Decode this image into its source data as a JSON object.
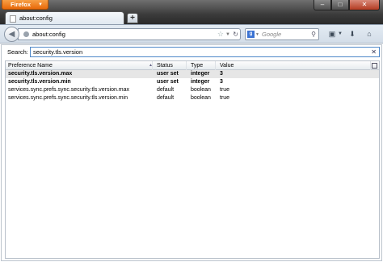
{
  "app": {
    "menu_button": "Firefox"
  },
  "window_controls": {
    "minimize": "–",
    "maximize": "□",
    "close": "✕"
  },
  "tabs": [
    {
      "title": "about:config"
    }
  ],
  "new_tab_label": "+",
  "navbar": {
    "url": "about:config",
    "search_placeholder": "Google",
    "search_engine_letter": "g"
  },
  "icons": {
    "back": "back-arrow-icon",
    "bookmark": "star-icon",
    "reload": "reload-icon",
    "search": "magnifier-icon",
    "bookmarks_menu": "bookmarks-icon",
    "downloads": "download-arrow-icon",
    "home": "home-icon"
  },
  "config": {
    "search_label": "Search:",
    "search_value": "security.tls.version",
    "columns": [
      "Preference Name",
      "Status",
      "Type",
      "Value"
    ],
    "rows": [
      {
        "name": "security.tls.version.max",
        "status": "user set",
        "type": "integer",
        "value": "3",
        "bold": true
      },
      {
        "name": "security.tls.version.min",
        "status": "user set",
        "type": "integer",
        "value": "3",
        "bold": true
      },
      {
        "name": "services.sync.prefs.sync.security.tls.version.max",
        "status": "default",
        "type": "boolean",
        "value": "true",
        "bold": false
      },
      {
        "name": "services.sync.prefs.sync.security.tls.version.min",
        "status": "default",
        "type": "boolean",
        "value": "true",
        "bold": false
      }
    ]
  },
  "colors": {
    "firefox_orange": "#e86a0a",
    "selected_row": "#e6e6e6"
  }
}
